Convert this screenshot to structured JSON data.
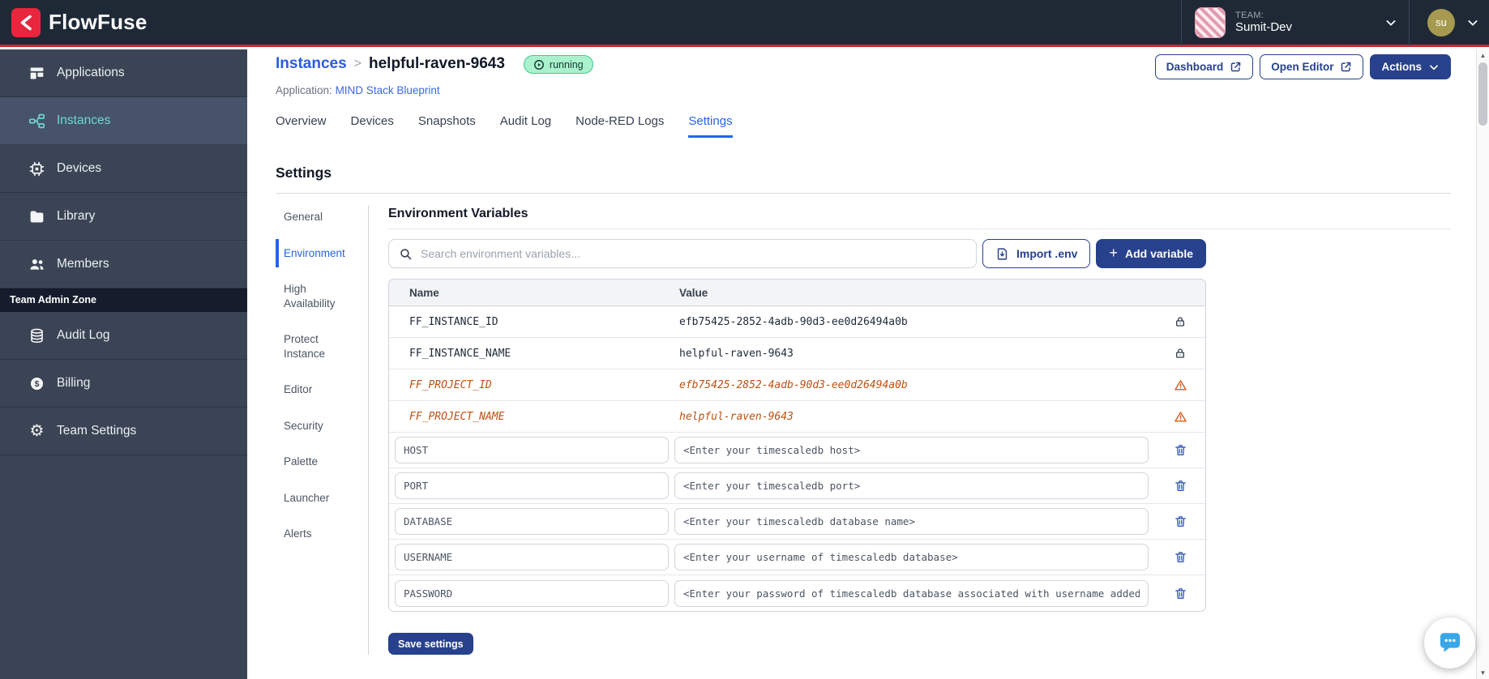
{
  "topbar": {
    "brand": "FlowFuse",
    "team_label": "TEAM:",
    "team_name": "Sumit-Dev",
    "user_initials": "su"
  },
  "sidebar": {
    "items": [
      "Applications",
      "Instances",
      "Devices",
      "Library",
      "Members"
    ],
    "admin_zone_label": "Team Admin Zone",
    "admin_items": [
      "Audit Log",
      "Billing",
      "Team Settings"
    ]
  },
  "header": {
    "breadcrumb_parent": "Instances",
    "separator": ">",
    "instance_name": "helpful-raven-9643",
    "status_label": "running",
    "application_label": "Application:",
    "application_name": "MIND Stack Blueprint",
    "dashboard_label": "Dashboard",
    "open_editor_label": "Open Editor",
    "actions_label": "Actions"
  },
  "tabs": [
    "Overview",
    "Devices",
    "Snapshots",
    "Audit Log",
    "Node-RED Logs",
    "Settings"
  ],
  "settings": {
    "title": "Settings",
    "subnav": [
      "General",
      "Environment",
      "High Availability",
      "Protect Instance",
      "Editor",
      "Security",
      "Palette",
      "Launcher",
      "Alerts"
    ],
    "section_title": "Environment Variables",
    "search_placeholder": "Search environment variables...",
    "import_label": "Import .env",
    "add_label": "Add variable",
    "save_label": "Save settings",
    "columns": {
      "name": "Name",
      "value": "Value"
    },
    "rows": [
      {
        "name": "FF_INSTANCE_ID",
        "value": "efb75425-2852-4adb-90d3-ee0d26494a0b",
        "state": "locked"
      },
      {
        "name": "FF_INSTANCE_NAME",
        "value": "helpful-raven-9643",
        "state": "locked"
      },
      {
        "name": "FF_PROJECT_ID",
        "value": "efb75425-2852-4adb-90d3-ee0d26494a0b",
        "state": "deprecated"
      },
      {
        "name": "FF_PROJECT_NAME",
        "value": "helpful-raven-9643",
        "state": "deprecated"
      },
      {
        "name": "HOST",
        "value": "<Enter your timescaledb host>",
        "state": "editable"
      },
      {
        "name": "PORT",
        "value": "<Enter your timescaledb port>",
        "state": "editable"
      },
      {
        "name": "DATABASE",
        "value": "<Enter your timescaledb database name>",
        "state": "editable"
      },
      {
        "name": "USERNAME",
        "value": "<Enter your username of timescaledb database>",
        "state": "editable"
      },
      {
        "name": "PASSWORD",
        "value": "<Enter your password of timescaledb database associated with username added",
        "state": "editable"
      }
    ]
  }
}
